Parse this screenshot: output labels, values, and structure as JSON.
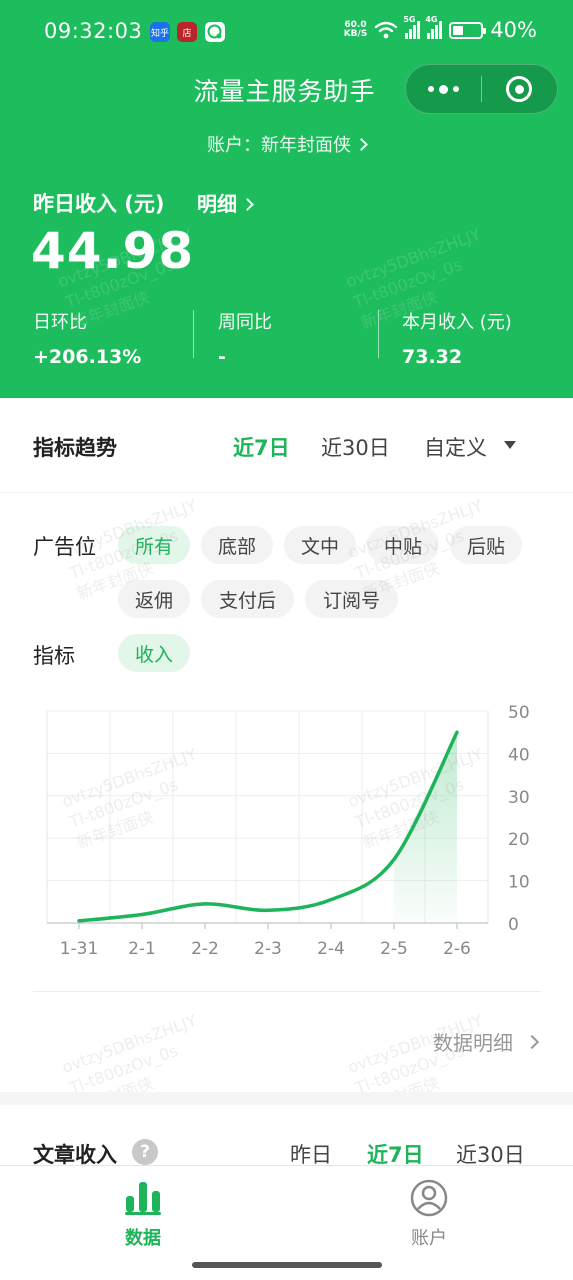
{
  "status_bar": {
    "time": "09:32:03",
    "app_badges": [
      {
        "text": "知乎",
        "color": "#1a73e8"
      },
      {
        "text": "店",
        "color": "#b8262b"
      },
      {
        "text": "",
        "color": "#ffffff"
      }
    ],
    "net_speed_value": "60.0",
    "net_speed_unit": "KB/S",
    "sig1_tag": "5G",
    "sig2_tag": "4G",
    "battery_level": 0.4,
    "battery": "40%"
  },
  "header": {
    "title": "流量主服务助手",
    "account_prefix": "账户：",
    "account_name": "新年封面侠",
    "yesterday_label": "昨日收入 (元)",
    "detail_label": "明细",
    "yesterday_value": "44.98",
    "stats": [
      {
        "label": "日环比",
        "value": "+206.13%"
      },
      {
        "label": "周同比",
        "value": "-"
      },
      {
        "label": "本月收入 (元)",
        "value": "73.32"
      }
    ]
  },
  "trend": {
    "title": "指标趋势",
    "ranges": [
      "近7日",
      "近30日",
      "自定义"
    ],
    "active_range": "近7日"
  },
  "filters": {
    "ad_slot_label": "广告位",
    "ad_slots": [
      "所有",
      "底部",
      "文中",
      "中贴",
      "后贴",
      "返佣",
      "支付后",
      "订阅号"
    ],
    "active_ad_slot": "所有",
    "metric_label": "指标",
    "metrics": [
      "收入"
    ],
    "active_metric": "收入"
  },
  "chart_data": {
    "type": "area",
    "categories": [
      "1-31",
      "2-1",
      "2-2",
      "2-3",
      "2-4",
      "2-5",
      "2-6"
    ],
    "series": [
      {
        "values": [
          0.5,
          2,
          4.5,
          3,
          5.5,
          15,
          44.98
        ]
      }
    ],
    "ylim": [
      0,
      50
    ],
    "yticks": [
      0,
      10,
      20,
      30,
      40,
      50
    ],
    "y_axis_position": "right",
    "grid": true,
    "line_color": "#1db45a",
    "highlight_from_category": "2-5"
  },
  "data_detail_label": "数据明细",
  "article": {
    "title": "文章收入",
    "help": "?",
    "ranges": [
      "昨日",
      "近7日",
      "近30日"
    ],
    "active_range": "近7日"
  },
  "tabbar": {
    "tabs": [
      {
        "label": "数据",
        "active": true
      },
      {
        "label": "账户",
        "active": false
      }
    ]
  },
  "colors": {
    "brand_green": "#1dbc5d",
    "accent_green": "#1db45a"
  }
}
